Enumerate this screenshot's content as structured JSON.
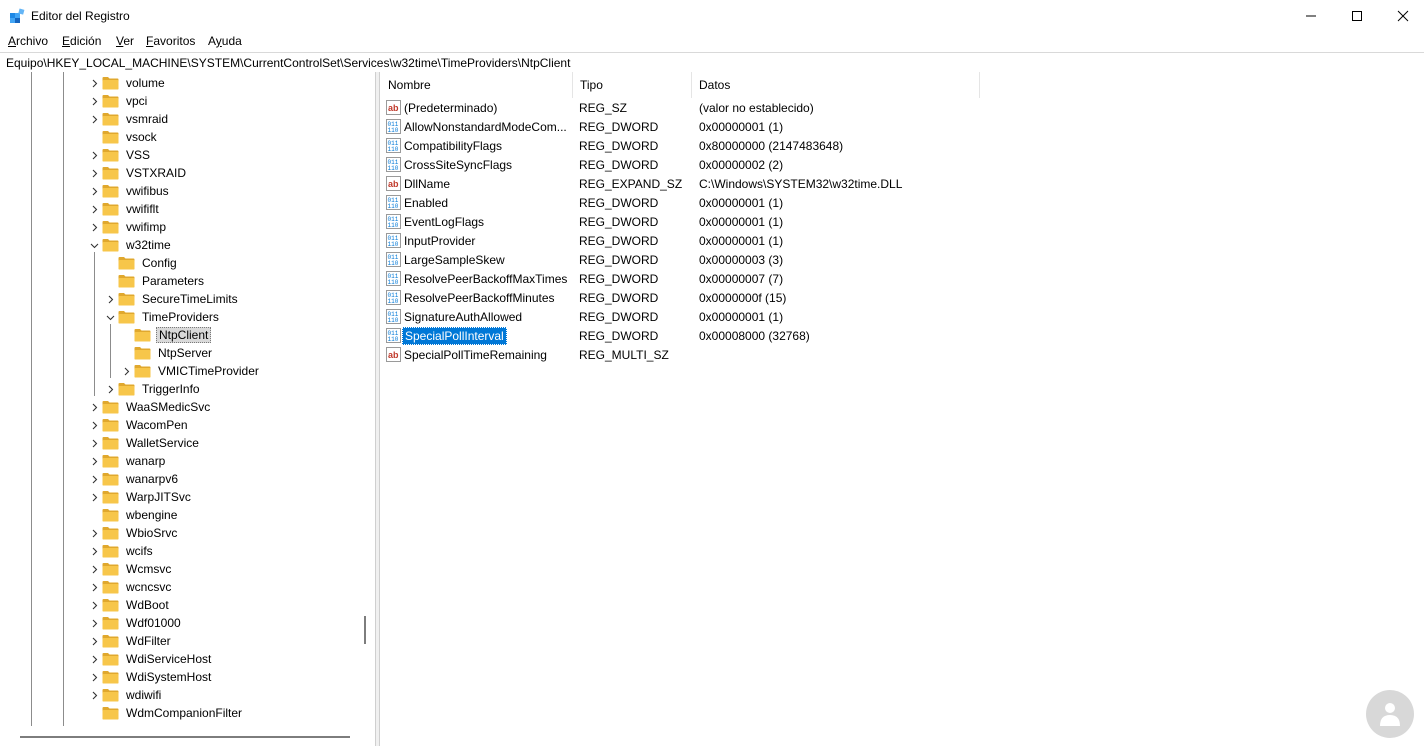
{
  "window": {
    "title": "Editor del Registro",
    "controls": {
      "minimize": "minimize",
      "maximize": "maximize",
      "close": "close"
    }
  },
  "menu": [
    {
      "prefix": "",
      "accel": "A",
      "rest": "rchivo"
    },
    {
      "prefix": "",
      "accel": "E",
      "rest": "dición"
    },
    {
      "prefix": "",
      "accel": "V",
      "rest": "er"
    },
    {
      "prefix": "",
      "accel": "F",
      "rest": "avoritos"
    },
    {
      "prefix": "A",
      "accel": "y",
      "rest": "uda"
    }
  ],
  "address": "Equipo\\HKEY_LOCAL_MACHINE\\SYSTEM\\CurrentControlSet\\Services\\w32time\\TimeProviders\\NtpClient",
  "colors": {
    "accent": "#0078d7",
    "folder": "#f7c64a",
    "folder_dark": "#e0a82e"
  },
  "tree": [
    {
      "label": "volume",
      "level": 0,
      "expander": "collapsed"
    },
    {
      "label": "vpci",
      "level": 0,
      "expander": "collapsed"
    },
    {
      "label": "vsmraid",
      "level": 0,
      "expander": "collapsed"
    },
    {
      "label": "vsock",
      "level": 0,
      "expander": "none"
    },
    {
      "label": "VSS",
      "level": 0,
      "expander": "collapsed"
    },
    {
      "label": "VSTXRAID",
      "level": 0,
      "expander": "collapsed"
    },
    {
      "label": "vwifibus",
      "level": 0,
      "expander": "collapsed"
    },
    {
      "label": "vwififlt",
      "level": 0,
      "expander": "collapsed"
    },
    {
      "label": "vwifimp",
      "level": 0,
      "expander": "collapsed"
    },
    {
      "label": "w32time",
      "level": 0,
      "expander": "expanded"
    },
    {
      "label": "Config",
      "level": 1,
      "expander": "none"
    },
    {
      "label": "Parameters",
      "level": 1,
      "expander": "none"
    },
    {
      "label": "SecureTimeLimits",
      "level": 1,
      "expander": "collapsed"
    },
    {
      "label": "TimeProviders",
      "level": 1,
      "expander": "expanded"
    },
    {
      "label": "NtpClient",
      "level": 2,
      "expander": "none",
      "selected": true
    },
    {
      "label": "NtpServer",
      "level": 2,
      "expander": "none"
    },
    {
      "label": "VMICTimeProvider",
      "level": 2,
      "expander": "collapsed"
    },
    {
      "label": "TriggerInfo",
      "level": 1,
      "expander": "collapsed"
    },
    {
      "label": "WaaSMedicSvc",
      "level": 0,
      "expander": "collapsed"
    },
    {
      "label": "WacomPen",
      "level": 0,
      "expander": "collapsed"
    },
    {
      "label": "WalletService",
      "level": 0,
      "expander": "collapsed"
    },
    {
      "label": "wanarp",
      "level": 0,
      "expander": "collapsed"
    },
    {
      "label": "wanarpv6",
      "level": 0,
      "expander": "collapsed"
    },
    {
      "label": "WarpJITSvc",
      "level": 0,
      "expander": "collapsed"
    },
    {
      "label": "wbengine",
      "level": 0,
      "expander": "none"
    },
    {
      "label": "WbioSrvc",
      "level": 0,
      "expander": "collapsed"
    },
    {
      "label": "wcifs",
      "level": 0,
      "expander": "collapsed"
    },
    {
      "label": "Wcmsvc",
      "level": 0,
      "expander": "collapsed"
    },
    {
      "label": "wcncsvc",
      "level": 0,
      "expander": "collapsed"
    },
    {
      "label": "WdBoot",
      "level": 0,
      "expander": "collapsed"
    },
    {
      "label": "Wdf01000",
      "level": 0,
      "expander": "collapsed"
    },
    {
      "label": "WdFilter",
      "level": 0,
      "expander": "collapsed"
    },
    {
      "label": "WdiServiceHost",
      "level": 0,
      "expander": "collapsed"
    },
    {
      "label": "WdiSystemHost",
      "level": 0,
      "expander": "collapsed"
    },
    {
      "label": "wdiwifi",
      "level": 0,
      "expander": "collapsed"
    },
    {
      "label": "WdmCompanionFilter",
      "level": 0,
      "expander": "none"
    }
  ],
  "list": {
    "columns": [
      "Nombre",
      "Tipo",
      "Datos"
    ],
    "rows": [
      {
        "icon": "string",
        "name": "(Predeterminado)",
        "type": "REG_SZ",
        "data": "(valor no establecido)"
      },
      {
        "icon": "binary",
        "name": "AllowNonstandardModeCom...",
        "type": "REG_DWORD",
        "data": "0x00000001 (1)"
      },
      {
        "icon": "binary",
        "name": "CompatibilityFlags",
        "type": "REG_DWORD",
        "data": "0x80000000 (2147483648)"
      },
      {
        "icon": "binary",
        "name": "CrossSiteSyncFlags",
        "type": "REG_DWORD",
        "data": "0x00000002 (2)"
      },
      {
        "icon": "string",
        "name": "DllName",
        "type": "REG_EXPAND_SZ",
        "data": "C:\\Windows\\SYSTEM32\\w32time.DLL"
      },
      {
        "icon": "binary",
        "name": "Enabled",
        "type": "REG_DWORD",
        "data": "0x00000001 (1)"
      },
      {
        "icon": "binary",
        "name": "EventLogFlags",
        "type": "REG_DWORD",
        "data": "0x00000001 (1)"
      },
      {
        "icon": "binary",
        "name": "InputProvider",
        "type": "REG_DWORD",
        "data": "0x00000001 (1)"
      },
      {
        "icon": "binary",
        "name": "LargeSampleSkew",
        "type": "REG_DWORD",
        "data": "0x00000003 (3)"
      },
      {
        "icon": "binary",
        "name": "ResolvePeerBackoffMaxTimes",
        "type": "REG_DWORD",
        "data": "0x00000007 (7)"
      },
      {
        "icon": "binary",
        "name": "ResolvePeerBackoffMinutes",
        "type": "REG_DWORD",
        "data": "0x0000000f (15)"
      },
      {
        "icon": "binary",
        "name": "SignatureAuthAllowed",
        "type": "REG_DWORD",
        "data": "0x00000001 (1)"
      },
      {
        "icon": "binary",
        "name": "SpecialPollInterval",
        "type": "REG_DWORD",
        "data": "0x00008000 (32768)",
        "selected": true
      },
      {
        "icon": "string",
        "name": "SpecialPollTimeRemaining",
        "type": "REG_MULTI_SZ",
        "data": ""
      }
    ]
  },
  "watermark": {
    "icon": "person-icon"
  }
}
